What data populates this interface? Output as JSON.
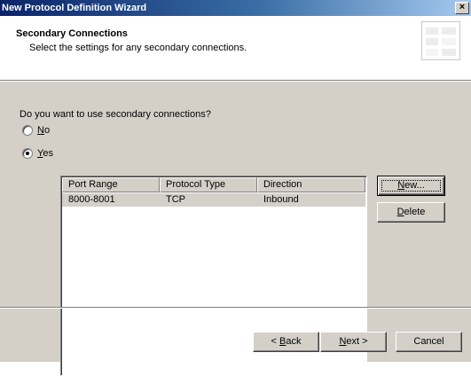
{
  "window": {
    "title": "New Protocol Definition Wizard",
    "close_glyph": "×"
  },
  "header": {
    "title": "Secondary Connections",
    "subtitle": "Select the settings for any secondary connections.",
    "graphic_icon": "wizard-banner-icon"
  },
  "question": "Do you want to use secondary connections?",
  "options": [
    {
      "accel": "N",
      "rest": "o",
      "label": "No",
      "selected": false
    },
    {
      "accel": "Y",
      "rest": "es",
      "label": "Yes",
      "selected": true
    }
  ],
  "table": {
    "columns": [
      "Port Range",
      "Protocol Type",
      "Direction"
    ],
    "rows": [
      {
        "port_range": "8000-8001",
        "protocol_type": "TCP",
        "direction": "Inbound",
        "selected": true
      }
    ]
  },
  "side_buttons": {
    "new": {
      "accel": "N",
      "rest": "ew...",
      "label": "New..."
    },
    "delete": {
      "accel": "D",
      "rest": "elete",
      "label": "Delete"
    }
  },
  "footer": {
    "back": {
      "prefix": "< ",
      "accel": "B",
      "rest": "ack",
      "label": "< Back"
    },
    "next": {
      "accel": "N",
      "rest": "ext >",
      "label": "Next >"
    },
    "cancel": "Cancel"
  }
}
